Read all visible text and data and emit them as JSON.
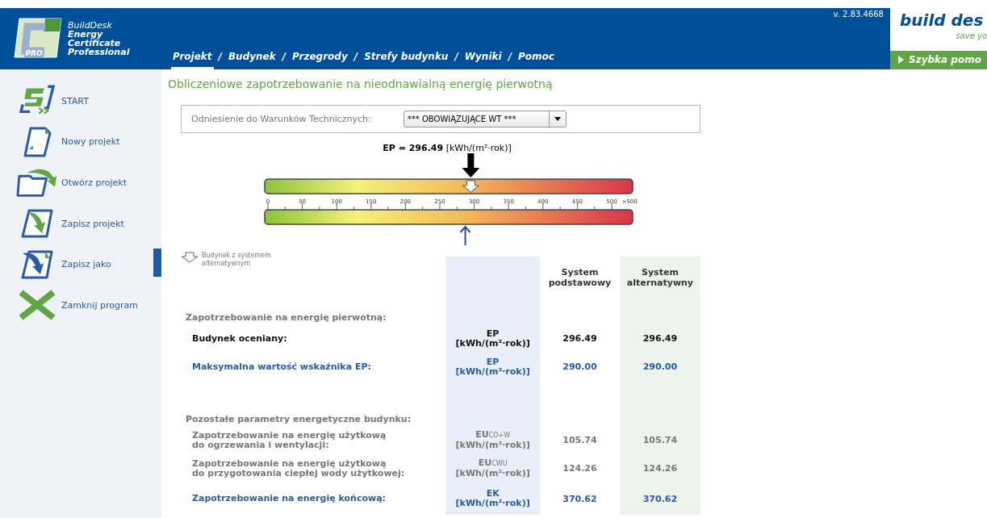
{
  "app": {
    "name_lines": [
      "BuildDesk",
      "Energy",
      "Certificate",
      "Professional"
    ],
    "badge": "PRO",
    "version": "v. 2.83.4668"
  },
  "nav": [
    {
      "label": "Projekt",
      "selected": true
    },
    {
      "label": "Budynek",
      "selected": false
    },
    {
      "label": "Przegrody",
      "selected": false
    },
    {
      "label": "Strefy budynku",
      "selected": false
    },
    {
      "label": "Wyniki",
      "selected": false
    },
    {
      "label": "Pomoc",
      "selected": false
    }
  ],
  "nav_separator": "/",
  "brand": {
    "logo": "build des",
    "tagline": "save yo",
    "help_button": "Szybka pomo"
  },
  "sidebar": {
    "items": [
      {
        "kind": "start",
        "label": "START"
      },
      {
        "kind": "new",
        "label": "Nowy projekt"
      },
      {
        "kind": "open",
        "label": "Otwórz projekt"
      },
      {
        "kind": "save",
        "label": "Zapisz projekt"
      },
      {
        "kind": "saveas",
        "label": "Zapisz jako"
      },
      {
        "kind": "close",
        "label": "Zamknij program"
      }
    ]
  },
  "page_title": "Obliczeniowe zapotrzebowanie na nieodnawialną energię pierwotną",
  "reference": {
    "label": "Odniesienie do Warunków Technicznych:",
    "value": "*** OBOWIĄZUJĄCE WT ***"
  },
  "gauge": {
    "caption": "**EP = 296.49** [kWh/(m²·rok)]",
    "ticks": [
      "0",
      "50",
      "100",
      "150",
      "200",
      "250",
      "300",
      "350",
      "400",
      "450",
      "500",
      ">500"
    ],
    "marker": {
      "level": 0.56
    },
    "alt_marker": {
      "level": 0.545
    }
  },
  "legend": {
    "text_lines": [
      "Budynek z systemem",
      "alternatywnym"
    ]
  },
  "table": {
    "columns": [
      "System podstawowy",
      "System alternatywny"
    ],
    "rows": [
      {
        "kind": "heading",
        "label": "Zapotrzebowanie na energię pierwotną:"
      },
      {
        "kind": "main",
        "label": "Budynek oceniany:",
        "symbol": "EP",
        "unit": "[kWh/(m²·rok)]",
        "basic": "296.49",
        "alternative": "296.49"
      },
      {
        "kind": "limit",
        "label": "Maksymalna wartość wskaźnika EP:",
        "symbol": "EP",
        "unit": "[kWh/(m²·rok)]",
        "basic": "290.00",
        "alternative": "290.00"
      },
      {
        "kind": "spacer"
      },
      {
        "kind": "heading",
        "label": "Pozostałe parametry energetyczne budynku:"
      },
      {
        "kind": "param",
        "label": "Zapotrzebowanie na energię użytkową\ndo ogrzewania i wentylacji:",
        "symbol": "EU$_{CO+W}$",
        "unit": "[kWh/(m²·rok)]",
        "basic": "105.74",
        "alternative": "105.74"
      },
      {
        "kind": "param",
        "label": "Zapotrzebowanie na energię użytkową\ndo przygotowania ciepłej wody użytkowej:",
        "symbol": "EU$_{CWU}$",
        "unit": "[kWh/(m²·rok)]",
        "basic": "124.26",
        "alternative": "124.26"
      },
      {
        "kind": "limit",
        "label": "Zapotrzebowanie na energię końcową:",
        "symbol": "EK",
        "unit": "[kWh/(m²·rok)]",
        "basic": "370.62",
        "alternative": "370.62"
      }
    ]
  }
}
